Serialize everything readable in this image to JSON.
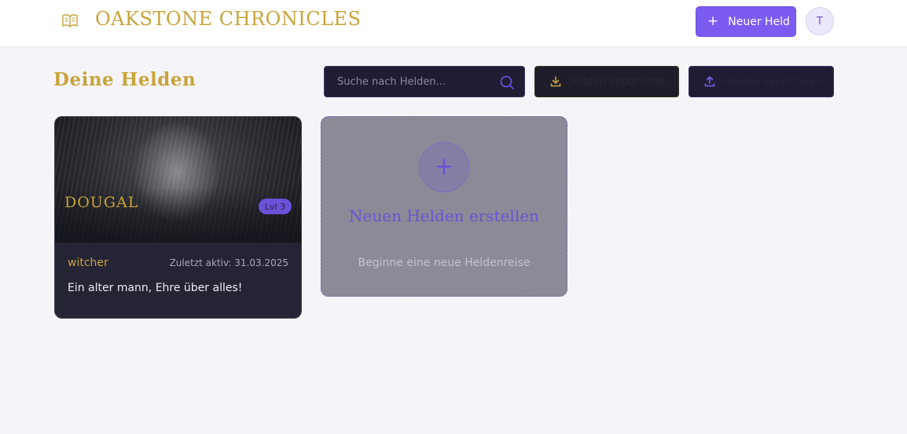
{
  "header": {
    "app_title": "OAKSTONE CHRONICLES",
    "logo_icon": "book-icon",
    "new_hero_button": {
      "icon": "plus-icon",
      "label": "Neuer Held"
    },
    "avatar_initial": "T"
  },
  "toolbar": {
    "section_title": "Deine Helden",
    "search": {
      "placeholder": "Suche nach Helden...",
      "value": "",
      "icon": "search-icon"
    },
    "import_button": {
      "icon": "download-icon",
      "label": "Helden importieren"
    },
    "export_button": {
      "icon": "upload-icon",
      "label": "Helden exportieren"
    }
  },
  "heroes": [
    {
      "name": "DOUGAL",
      "level": "Lvl 3",
      "class": "witcher",
      "last_active": "Zuletzt aktiv: 31.03.2025",
      "description": "Ein alter mann, Ehre über alles!"
    }
  ],
  "create_card": {
    "icon": "plus-icon",
    "title": "Neuen Helden erstellen",
    "subtitle": "Beginne eine neue Heldenreise"
  },
  "colors": {
    "accent_gold": "#c9a43a",
    "accent_purple": "#7c5cf0",
    "card_dark": "#252434",
    "background": "#f5f4f8"
  }
}
